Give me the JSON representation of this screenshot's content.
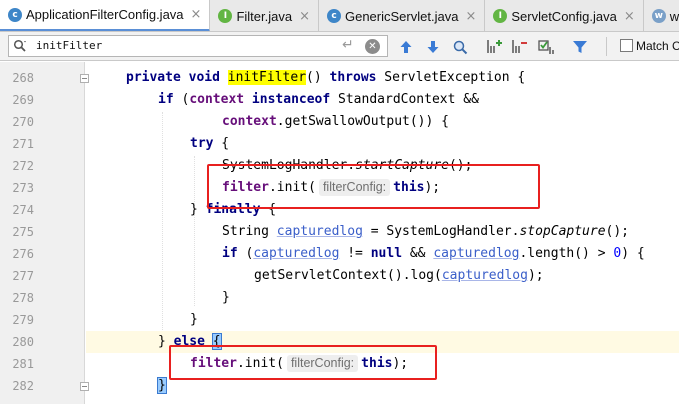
{
  "tabs": [
    {
      "label": "ApplicationFilterConfig.java",
      "icon": "class-file-icon",
      "active": true
    },
    {
      "label": "Filter.java",
      "icon": "interface-file-icon",
      "active": false
    },
    {
      "label": "GenericServlet.java",
      "icon": "class-file-icon",
      "active": false
    },
    {
      "label": "ServletConfig.java",
      "icon": "interface-file-icon",
      "active": false
    },
    {
      "label": "we",
      "icon": "web-file-icon",
      "active": false
    }
  ],
  "search": {
    "value": "initFilter",
    "match_case_label": "Match C"
  },
  "editor": {
    "line_numbers": [
      "268",
      "269",
      "270",
      "271",
      "272",
      "273",
      "274",
      "275",
      "276",
      "277",
      "278",
      "279",
      "280",
      "281",
      "282"
    ],
    "hint_label": "filterConfig:",
    "code": {
      "l268": {
        "kw1": "private void ",
        "method": "initFilter",
        "rest1": "() ",
        "kw2": "throws",
        "rest2": " ServletException {"
      },
      "l269": {
        "kw1": "if",
        "rest1": " (",
        "fld": "context",
        "kw2": " instanceof",
        "rest2": " StandardContext &&"
      },
      "l270": {
        "fld": "context",
        "rest": ".getSwallowOutput()) {"
      },
      "l271": {
        "kw": "try",
        "rest": " {"
      },
      "l272": {
        "pre": "SystemLogHandler.",
        "it": "startCapture",
        "rest": "();"
      },
      "l273": {
        "fld": "filter",
        "call": ".init(",
        "kw": "this",
        "rest": ");"
      },
      "l274": {
        "pre": "} ",
        "kw": "finally",
        "rest": " {"
      },
      "l275": {
        "pre": "String ",
        "var": "capturedlog",
        "mid": " = SystemLogHandler.",
        "it": "stopCapture",
        "rest": "();"
      },
      "l276": {
        "kw1": "if",
        "p1": " (",
        "var1": "capturedlog",
        "p2": " != ",
        "kw2": "null",
        "p3": " && ",
        "var2": "capturedlog",
        "p4": ".length() > ",
        "num": "0",
        "p5": ") {"
      },
      "l277": {
        "pre": "getServletContext().log(",
        "var": "capturedlog",
        "rest": ");"
      },
      "l278": {
        "text": "}"
      },
      "l279": {
        "text": "}"
      },
      "l280": {
        "pre": "} ",
        "kw": "else",
        "sp": " ",
        "brace": "{"
      },
      "l281": {
        "fld": "filter",
        "call": ".init(",
        "kw": "this",
        "rest": ");"
      },
      "l282": {
        "brace": "}"
      }
    }
  },
  "colors": {
    "keyword": "#000080",
    "field": "#660e7a",
    "search_highlight": "#ffff00",
    "annotation_box": "#e8201f"
  }
}
